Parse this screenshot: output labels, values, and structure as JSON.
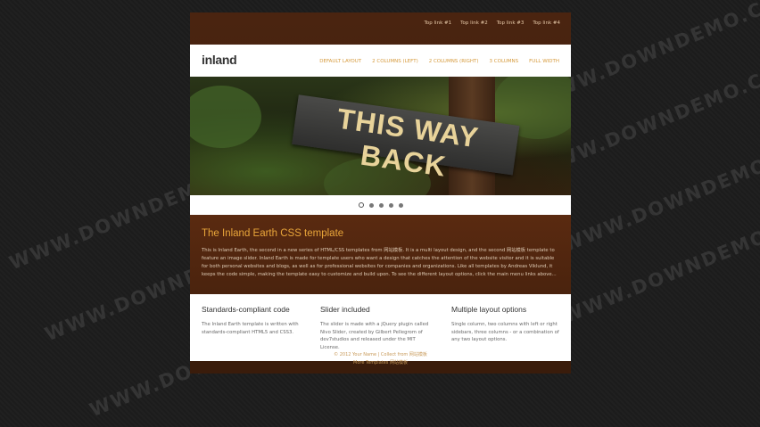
{
  "toplinks": [
    "Top link #1",
    "Top link #2",
    "Top link #3",
    "Top link #4"
  ],
  "header": {
    "logo": "inland"
  },
  "nav": [
    "Default layout",
    "2 columns (left)",
    "2 columns (right)",
    "3 columns",
    "Full width"
  ],
  "slider": {
    "sign_text": "THIS WAY BACK",
    "dots": 5,
    "active_dot": 0
  },
  "intro": {
    "title": "The Inland Earth CSS template",
    "text": "This is Inland Earth, the second in a new series of HTML/CSS templates from 网站模板. It is a multi layout design, and the second 网站模板 template to feature an image slider. Inland Earth is made for template users who want a design that catches the attention of the website visitor and it is suitable for both personal websites and blogs, as well as for professional websites for companies and organizations. Like all templates by Andreas Viklund, it keeps the code simple, making the template easy to customize and build upon. To see the different layout options, click the main menu links above..."
  },
  "features": [
    {
      "title": "Standards-compliant code",
      "text": "The Inland Earth template is written with standards-compliant HTML5 and CSS3."
    },
    {
      "title": "Slider included",
      "text": "The slider is made with a jQuery plugin called Nivo Slider, created by Gilbert Pellegrom of dev7studios and released under the MIT License."
    },
    {
      "title": "Multiple layout options",
      "text": "Single column, two columns with left or right sidebars, three columns - or a combination of any two layout options."
    }
  ],
  "footer": {
    "line1": "© 2012 Your Name | Collect from 网站模板",
    "line2": "More Templates 网站模板"
  },
  "watermark": "WWW.DOWNDEMO.COM"
}
